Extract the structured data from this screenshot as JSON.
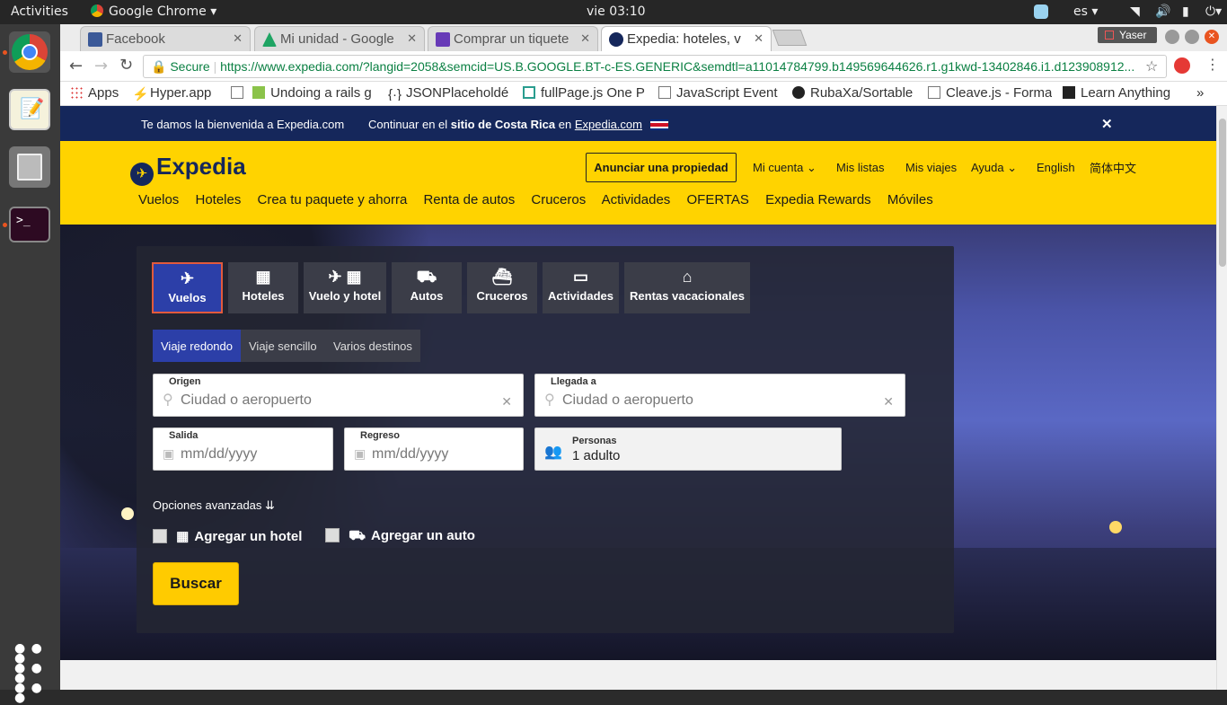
{
  "ubuntu": {
    "activities": "Activities",
    "app_name": "Google Chrome",
    "clock": "vie 03:10",
    "lang": "es",
    "user": "Yaser"
  },
  "tabs": [
    {
      "label": "Facebook",
      "color": "#3b5998"
    },
    {
      "label": "Mi unidad - Google",
      "color": "#1fa463"
    },
    {
      "label": "Comprar un tiquete",
      "color": "#673ab7"
    },
    {
      "label": "Expedia: hoteles, v",
      "color": "#15275b"
    }
  ],
  "omnibox": {
    "secure_label": "Secure",
    "url": "https://www.expedia.com/?langid=2058&semcid=US.B.GOOGLE.BT-c-ES.GENERIC&semdtl=a11014784799.b149569644626.r1.g1kwd-13402846.i1.d123908912..."
  },
  "bookmarks": [
    {
      "label": "Apps"
    },
    {
      "label": "Hyper.app"
    },
    {
      "label": "Undoing a rails g"
    },
    {
      "label": "JSONPlaceholdé"
    },
    {
      "label": "fullPage.js One P"
    },
    {
      "label": "JavaScript Event"
    },
    {
      "label": "RubaXa/Sortable"
    },
    {
      "label": "Cleave.js - Forma"
    },
    {
      "label": "Learn Anything"
    }
  ],
  "welcome": {
    "text": "Te damos la bienvenida a Expedia.com",
    "continue_prefix": "Continuar en el",
    "continue_bold": "sitio de Costa Rica",
    "continue_mid": "en",
    "continue_link": "Expedia.com"
  },
  "header": {
    "logo": "Expedia",
    "list_property": "Anunciar una propiedad",
    "account": "Mi cuenta",
    "lists": "Mis listas",
    "trips": "Mis viajes",
    "help": "Ayuda",
    "english": "English",
    "chinese": "简体中文",
    "nav": [
      "Vuelos",
      "Hoteles",
      "Crea tu paquete y ahorra",
      "Renta de autos",
      "Cruceros",
      "Actividades",
      "OFERTAS",
      "Expedia Rewards",
      "Móviles"
    ]
  },
  "search": {
    "tabs": [
      "Vuelos",
      "Hoteles",
      "Vuelo y hotel",
      "Autos",
      "Cruceros",
      "Actividades",
      "Rentas vacacionales"
    ],
    "subtabs": [
      "Viaje redondo",
      "Viaje sencillo",
      "Varios destinos"
    ],
    "origin_label": "Origen",
    "origin_placeholder": "Ciudad o aeropuerto",
    "dest_label": "Llegada a",
    "dest_placeholder": "Ciudad o aeropuerto",
    "depart_label": "Salida",
    "depart_placeholder": "mm/dd/yyyy",
    "return_label": "Regreso",
    "return_placeholder": "mm/dd/yyyy",
    "people_label": "Personas",
    "people_value": "1 adulto",
    "advanced": "Opciones avanzadas",
    "add_hotel": "Agregar un hotel",
    "add_car": "Agregar un auto",
    "submit": "Buscar"
  },
  "colors": {
    "expedia_yellow": "#ffd300",
    "expedia_navy": "#15275b",
    "tab_active": "#2c3fa8"
  }
}
